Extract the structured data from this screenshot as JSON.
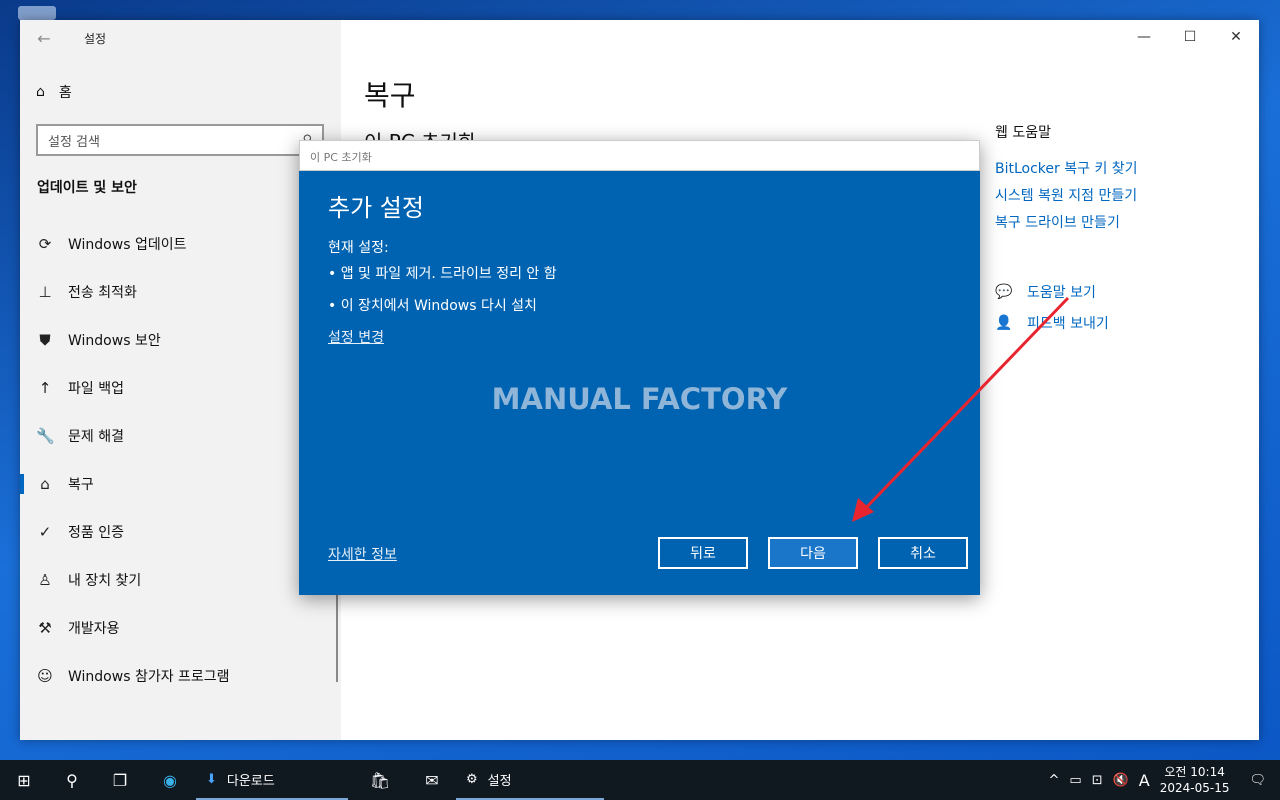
{
  "window": {
    "app_title": "설정",
    "back": "←",
    "min": "—",
    "max": "☐",
    "close": "✕"
  },
  "sidebar": {
    "home_label": "홈",
    "search_placeholder": "설정 검색",
    "section_title": "업데이트 및 보안",
    "items": [
      {
        "label": "Windows 업데이트",
        "icon": "⟳"
      },
      {
        "label": "전송 최적화",
        "icon": "⊥"
      },
      {
        "label": "Windows 보안",
        "icon": "⛊"
      },
      {
        "label": "파일 백업",
        "icon": "↑"
      },
      {
        "label": "문제 해결",
        "icon": "🔧"
      },
      {
        "label": "복구",
        "icon": "⌂"
      },
      {
        "label": "정품 인증",
        "icon": "✓"
      },
      {
        "label": "내 장치 찾기",
        "icon": "♙"
      },
      {
        "label": "개발자용",
        "icon": "⚒"
      },
      {
        "label": "Windows 참가자 프로그램",
        "icon": "☺"
      }
    ]
  },
  "main": {
    "title": "복구",
    "subtitle": "이 PC 초기화"
  },
  "help": {
    "title": "웹 도움말",
    "links": [
      "BitLocker 복구 키 찾기",
      "시스템 복원 지점 만들기",
      "복구 드라이브 만들기"
    ],
    "get_help": "도움말 보기",
    "feedback": "피드백 보내기"
  },
  "dialog": {
    "bar_title": "이 PC 초기화",
    "heading": "추가 설정",
    "current_label": "현재 설정:",
    "bullets": [
      "• 앱 및 파일 제거. 드라이브 정리 안 함",
      "• 이 장치에서 Windows 다시 설치"
    ],
    "change_link": "설정 변경",
    "watermark": "MANUAL FACTORY",
    "more_info": "자세한 정보",
    "back_btn": "뒤로",
    "next_btn": "다음",
    "cancel_btn": "취소"
  },
  "taskbar": {
    "downloads": "다운로드",
    "settings": "설정",
    "ime": "A",
    "time": "오전 10:14",
    "date": "2024-05-15"
  },
  "colors": {
    "accent": "#0067c0",
    "dialog_bg": "#0063b1",
    "arrow": "#e8242e"
  }
}
